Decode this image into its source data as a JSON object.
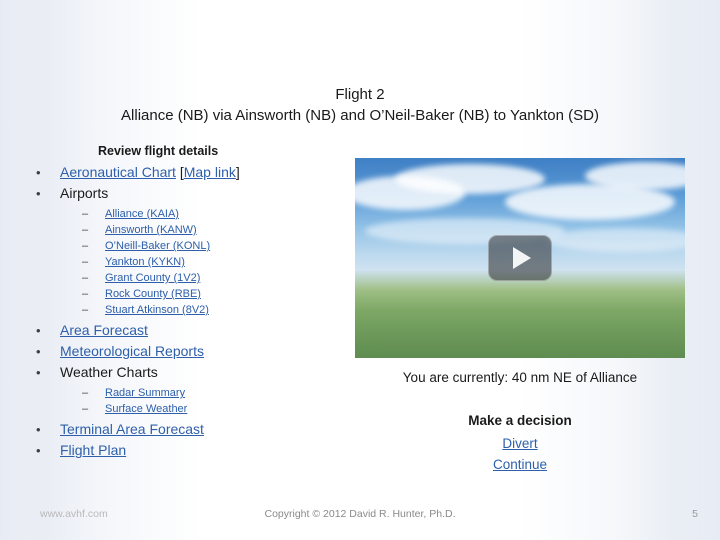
{
  "slide": {
    "title_line1": "Flight 2",
    "title_line2": "Alliance (NB) via Ainsworth (NB) and O’Neil-Baker (NB) to Yankton (SD)",
    "review_heading": "Review flight details",
    "bullets": [
      {
        "label": "Aeronautical Chart",
        "link": true,
        "suffix_open": "[",
        "suffix_link": "Map link",
        "suffix_close": "]"
      },
      {
        "label": "Airports",
        "link": false,
        "children": [
          "Alliance (KAIA)",
          "Ainsworth (KANW)",
          "O’Neill-Baker (KONL)",
          "Yankton (KYKN)",
          "Grant County (1V2)",
          "Rock County (RBE)",
          "Stuart Atkinson (8V2)"
        ]
      },
      {
        "label": "Area Forecast",
        "link": true
      },
      {
        "label": "Meteorological Reports",
        "link": true
      },
      {
        "label": "Weather Charts",
        "link": false,
        "children": [
          "Radar Summary",
          "Surface Weather"
        ]
      },
      {
        "label": "Terminal Area Forecast",
        "link": true
      },
      {
        "label": "Flight Plan",
        "link": true
      }
    ],
    "bullet_glyph": "•",
    "sub_bullet_glyph": "–",
    "video": {
      "play_label": "play-button"
    },
    "status_text": "You are currently: 40 nm NE of Alliance",
    "decision_heading": "Make a decision",
    "decision_options": [
      "Divert",
      "Continue"
    ],
    "footer": {
      "site": "www.avhf.com",
      "copyright": "Copyright © 2012 David R. Hunter, Ph.D.",
      "page_number": "5"
    }
  }
}
